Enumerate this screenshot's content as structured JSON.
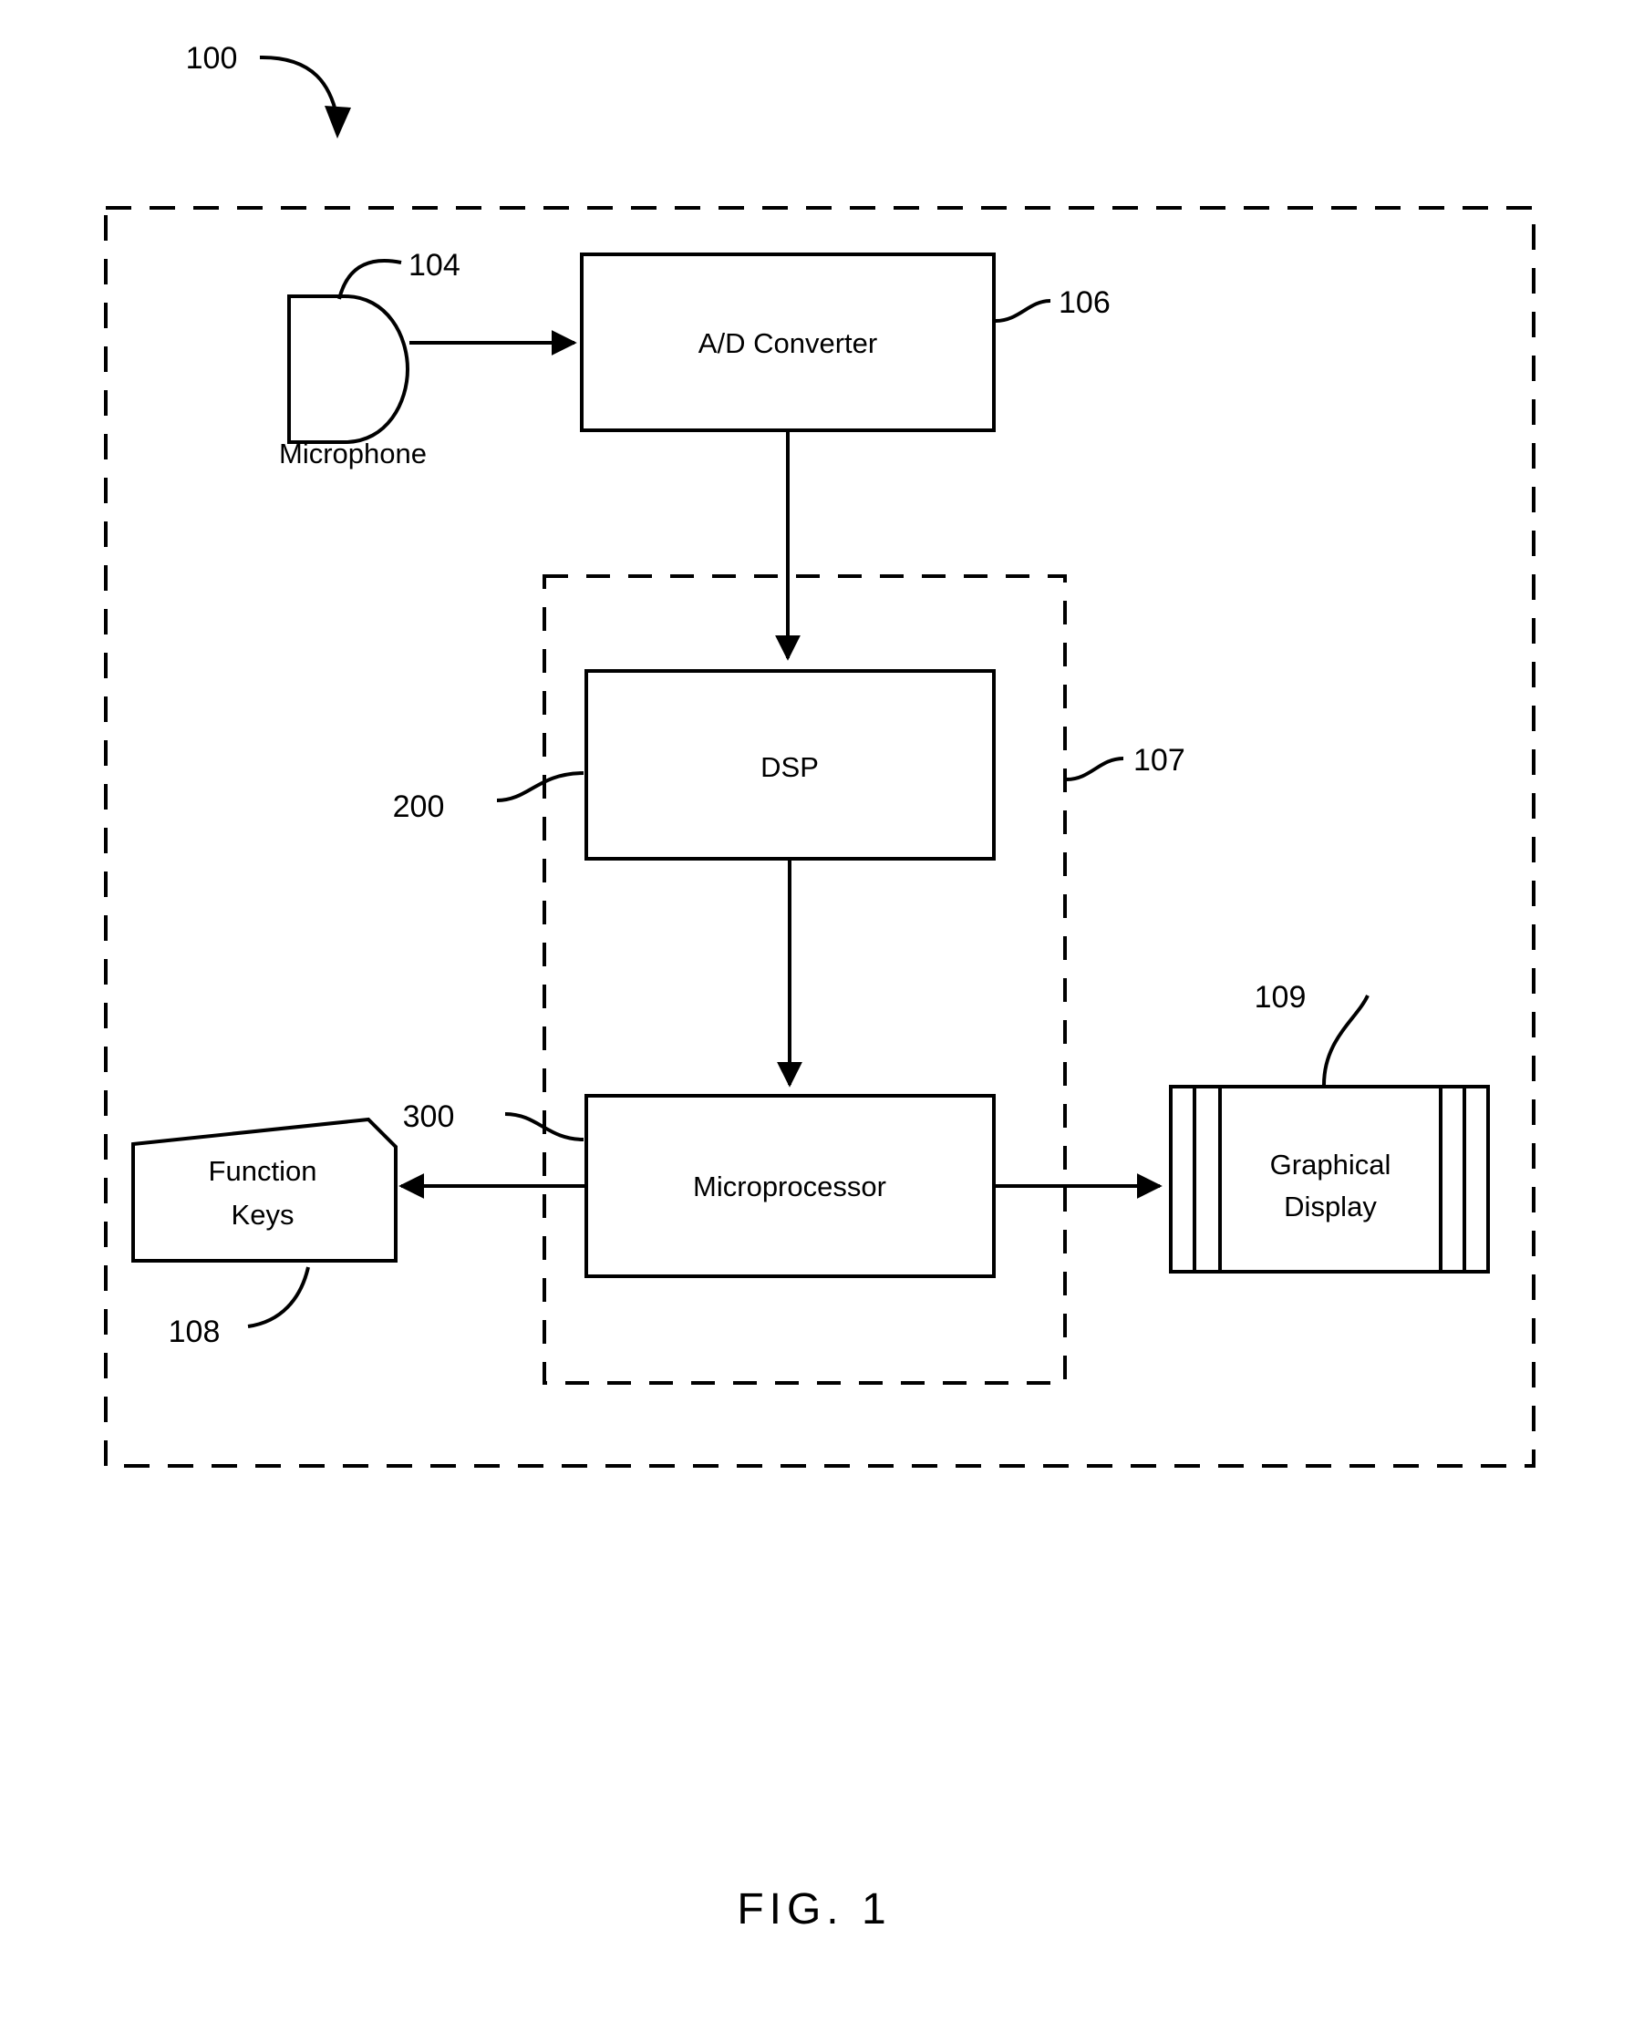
{
  "figure": {
    "caption": "FIG.  1",
    "top_reference": "100"
  },
  "blocks": [
    {
      "id": "microphone",
      "label": "Microphone",
      "reference": "104"
    },
    {
      "id": "ad-converter",
      "label": "A/D Converter",
      "reference": "106"
    },
    {
      "id": "dsp",
      "label": "DSP",
      "reference": "200"
    },
    {
      "id": "microprocessor",
      "label": "Microprocessor",
      "reference": "300"
    },
    {
      "id": "function-keys",
      "label_line1": "Function",
      "label_line2": "Keys",
      "reference": "108"
    },
    {
      "id": "graphical-display",
      "label_line1": "Graphical",
      "label_line2": "Display",
      "reference": "109"
    },
    {
      "id": "inner-enclosure",
      "label": "",
      "reference": "107"
    }
  ],
  "references": {
    "system": "100",
    "microphone": "104",
    "ad_converter": "106",
    "inner_enclosure": "107",
    "function_keys": "108",
    "graphical_display": "109",
    "dsp": "200",
    "microprocessor": "300"
  },
  "labels": {
    "microphone": "Microphone",
    "ad_converter": "A/D Converter",
    "dsp": "DSP",
    "microprocessor": "Microprocessor",
    "function_keys_1": "Function",
    "function_keys_2": "Keys",
    "graphical_display_1": "Graphical",
    "graphical_display_2": "Display",
    "caption": "FIG.  1"
  }
}
